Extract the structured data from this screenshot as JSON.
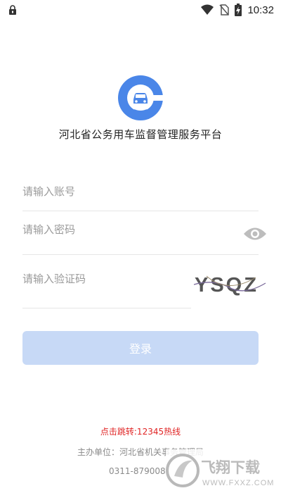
{
  "status_bar": {
    "time": "10:32",
    "icons": [
      "lock-icon",
      "wifi-icon",
      "no-sim-icon",
      "battery-charging-icon"
    ]
  },
  "app": {
    "title": "河北省公务用车监督管理服务平台",
    "logo": "car-location-logo",
    "brand_color": "#4a86e8"
  },
  "form": {
    "account_placeholder": "请输入账号",
    "password_placeholder": "请输入密码",
    "captcha_placeholder": "请输入验证码",
    "captcha_text": "YSQZ",
    "login_label": "登录",
    "button_color": "#c7d9f6"
  },
  "footer": {
    "hotline": "点击跳转:12345热线",
    "sponsor": "主办单位：河北省机关事务管理局",
    "phone": "0311-879008"
  },
  "watermark": {
    "text": "飞翔下载",
    "url_text": "WWW.FXXZ.COM"
  }
}
